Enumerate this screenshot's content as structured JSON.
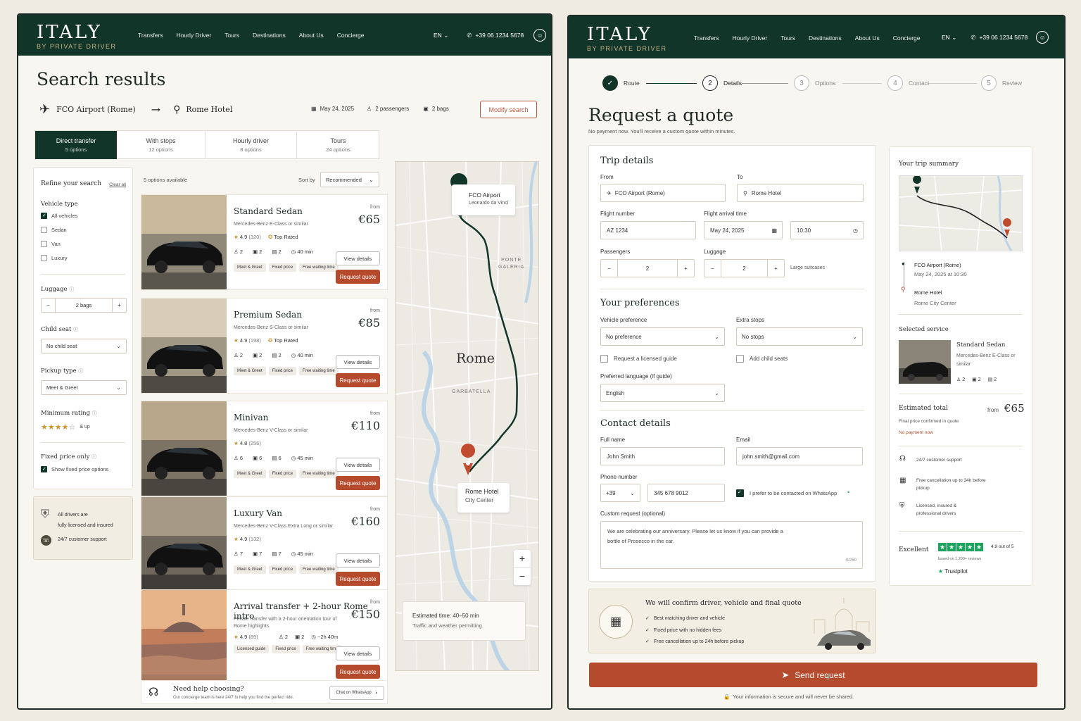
{
  "nav": {
    "logo_title": "ITALY",
    "logo_sub": "BY PRIVATE DRIVER",
    "links": [
      "Transfers",
      "Hourly Driver",
      "Tours",
      "Destinations",
      "About Us",
      "Concierge"
    ],
    "lang": "EN",
    "phone": "+39 06 1234 5678"
  },
  "colors": {
    "primary": "#12352a",
    "accent": "#b64a2c",
    "gold": "#c9952d",
    "background": "#f8f6f1"
  },
  "search": {
    "title": "Search results",
    "from": "FCO Airport (Rome)",
    "to": "Rome Hotel",
    "date": "May 24, 2025",
    "passengers": "2 passengers",
    "bags": "2 bags",
    "modify": "Modify search"
  },
  "tabs": [
    {
      "label": "Direct transfer",
      "count": "5 options",
      "active": true
    },
    {
      "label": "With stops",
      "count": "12 options"
    },
    {
      "label": "Hourly driver",
      "count": "8 options"
    },
    {
      "label": "Tours",
      "count": "24 options"
    }
  ],
  "filters": {
    "title": "Refine your search",
    "clear": "Clear all",
    "vehicle_type": "Vehicle type",
    "vehicle_options": [
      "All vehicles",
      "Sedan",
      "Van",
      "Luxury"
    ],
    "luggage": "Luggage",
    "luggage_value": "2 bags",
    "child_seat": "Child seat",
    "child_seat_value": "No child seat",
    "pickup_type": "Pickup type",
    "pickup_value": "Meet & Greet",
    "min_rating": "Minimum rating",
    "min_rating_value": 4,
    "and_up": "& up",
    "fixed_price": "Fixed price only",
    "fixed_price_opt": "Show fixed price options"
  },
  "trust": {
    "line1": "All drivers are",
    "line2": "fully licensed and insured",
    "support": "24/7 customer support"
  },
  "results_meta": {
    "count": "5 options available",
    "sort_label": "Sort by",
    "sort_value": "Recommended"
  },
  "results": [
    {
      "title": "Standard Sedan",
      "sub": "Mercedes-Benz E-Class or similar",
      "rating": "4.9",
      "reviews": "(320)",
      "badge": "Top Rated",
      "pax": "2",
      "bags": "2",
      "lug": "2",
      "time": "40 min",
      "tags": [
        "Meet & Greet",
        "Fixed price",
        "Free waiting time"
      ],
      "from": "from",
      "price": "€65",
      "view": "View details",
      "quote": "Request quote"
    },
    {
      "title": "Premium Sedan",
      "sub": "Mercedes-Benz S-Class or similar",
      "rating": "4.9",
      "reviews": "(198)",
      "badge": "Top Rated",
      "pax": "2",
      "bags": "2",
      "lug": "2",
      "time": "40 min",
      "tags": [
        "Meet & Greet",
        "Fixed price",
        "Free waiting time"
      ],
      "from": "from",
      "price": "€85",
      "view": "View details",
      "quote": "Request quote"
    },
    {
      "title": "Minivan",
      "sub": "Mercedes-Benz V-Class or similar",
      "rating": "4.8",
      "reviews": "(256)",
      "badge": "",
      "pax": "6",
      "bags": "6",
      "lug": "6",
      "time": "45 min",
      "tags": [
        "Meet & Greet",
        "Fixed price",
        "Free waiting time"
      ],
      "from": "from",
      "price": "€110",
      "view": "View details",
      "quote": "Request quote"
    },
    {
      "title": "Luxury Van",
      "sub": "Mercedes-Benz V-Class Extra Long or similar",
      "rating": "4.9",
      "reviews": "(132)",
      "badge": "",
      "pax": "7",
      "bags": "7",
      "lug": "7",
      "time": "45 min",
      "tags": [
        "Meet & Greet",
        "Fixed price",
        "Free waiting time"
      ],
      "from": "from",
      "price": "€160",
      "view": "View details",
      "quote": "Request quote"
    },
    {
      "title": "Arrival transfer + 2-hour Rome intro",
      "sub": "Private transfer with a 2-hour orientation tour of Rome highlights",
      "rating": "4.9",
      "reviews": "(89)",
      "badge": "",
      "pax": "2",
      "bags": "2",
      "lug": "",
      "time": "~2h 40m",
      "tags": [
        "Licensed guide",
        "Fixed price",
        "Free waiting time"
      ],
      "from": "from",
      "price": "€150",
      "view": "View details",
      "quote": "Request quote"
    }
  ],
  "help": {
    "title": "Need help choosing?",
    "sub": "Our concierge team is here 24/7 to help you find the perfect ride.",
    "btn": "Chat on WhatsApp"
  },
  "map": {
    "start": "FCO Airport",
    "start_sub": "Leonardo da Vinci",
    "end": "Rome Hotel",
    "end_sub": "City Center",
    "city": "Rome",
    "area1": "PONTE",
    "area2": "GALERIA",
    "area3": "GARBATELLA",
    "est": "Estimated time: 40–50 min",
    "est_sub": "Traffic and weather permitting"
  },
  "steps": [
    {
      "n": "1",
      "label": "Route",
      "done": true
    },
    {
      "n": "2",
      "label": "Details",
      "active": true
    },
    {
      "n": "3",
      "label": "Options"
    },
    {
      "n": "4",
      "label": "Contact"
    },
    {
      "n": "5",
      "label": "Review"
    }
  ],
  "quote": {
    "title": "Request a quote",
    "sub": "No payment now. You'll receive a custom quote within minutes.",
    "trip_title": "Trip details",
    "from_label": "From",
    "from_value": "FCO Airport (Rome)",
    "to_label": "To",
    "to_value": "Rome Hotel",
    "flight_label": "Flight number",
    "flight_placeholder": "AZ 1234",
    "arrival_label": "Flight arrival time",
    "arrival_date": "May 24, 2025",
    "arrival_time": "10:30",
    "passengers_label": "Passengers",
    "passengers_value": "2",
    "luggage_label": "Luggage",
    "luggage_value": "2",
    "large": "Large suitcases",
    "pref_title": "Your preferences",
    "vehicle_label": "Vehicle preference",
    "vehicle_value": "No preference",
    "stops_label": "Extra stops",
    "stops_value": "No stops",
    "guide": "Request a licensed guide",
    "child": "Add child seats",
    "lang_label": "Preferred language (if guide)",
    "lang_value": "English",
    "contact_title": "Contact details",
    "name_label": "Full name",
    "name_value": "John Smith",
    "email_label": "Email",
    "email_value": "john.smith@gmail.com",
    "phone_label": "Phone number",
    "phone_code": "+39",
    "phone_value": "345 678 9012",
    "whatsapp": "I prefer to be contacted on WhatsApp",
    "custom_label": "Custom request (optional)",
    "custom_value": "We are celebrating our anniversary. Please let us know if you can provide a bottle of Prosecco in the car.",
    "counter": "0/250",
    "confirm_title": "We will confirm driver, vehicle and final quote",
    "confirm_items": [
      "Best matching driver and vehicle",
      "Fixed price with no hidden fees",
      "Free cancellation up to 24h before pickup"
    ],
    "send": "Send request",
    "secure": "Your information is secure and will never be shared."
  },
  "summary": {
    "title": "Your trip summary",
    "from": "FCO Airport (Rome)",
    "from_sub": "May 24, 2025 at 10:30",
    "to": "Rome Hotel",
    "to_sub": "Rome City Center",
    "service_label": "Selected service",
    "service_name": "Standard Sedan",
    "service_sub": "Mercedes-Benz E-Class or similar",
    "pax": "2",
    "bags": "2",
    "lug": "2",
    "total_label": "Estimated total",
    "total_from": "from",
    "total_price": "€65",
    "total_note": "Final price confirmed in quote",
    "no_payment": "No payment now",
    "perks": [
      "24/7 customer support",
      "Free cancellation up to 24h before pickup",
      "Licensed, insured & professional drivers"
    ],
    "excellent": "Excellent",
    "score": "4.9 out of 5",
    "based": "based on 1,200+ reviews",
    "trustpilot": "Trustpilot"
  }
}
